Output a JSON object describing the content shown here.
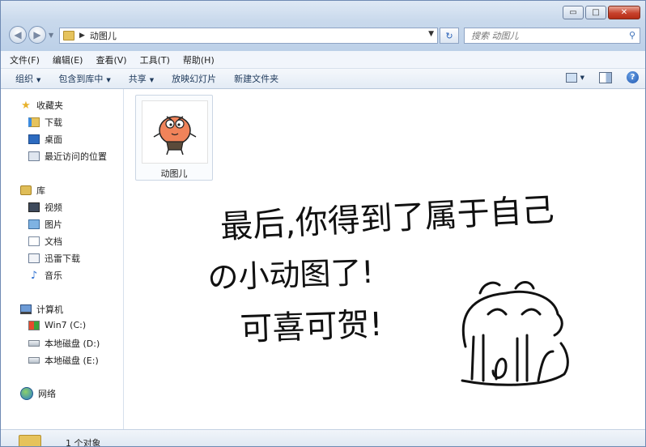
{
  "window": {
    "caption_buttons": {
      "minimize": "▭",
      "maximize": "□",
      "close": "✕"
    }
  },
  "toolbar": {
    "address_path": "动图儿",
    "search_placeholder": "搜索 动图儿"
  },
  "menubar": {
    "items": [
      "文件(F)",
      "编辑(E)",
      "查看(V)",
      "工具(T)",
      "帮助(H)"
    ]
  },
  "commandbar": {
    "items": [
      "组织",
      "包含到库中",
      "共享",
      "放映幻灯片",
      "新建文件夹"
    ]
  },
  "navpane": {
    "favorites": {
      "label": "收藏夹",
      "items": [
        "下载",
        "桌面",
        "最近访问的位置"
      ]
    },
    "libraries": {
      "label": "库",
      "items": [
        "视频",
        "图片",
        "文档",
        "迅雷下载",
        "音乐"
      ]
    },
    "computer": {
      "label": "计算机",
      "items": [
        "Win7 (C:)",
        "本地磁盘 (D:)",
        "本地磁盘 (E:)"
      ]
    },
    "network": {
      "label": "网络"
    }
  },
  "content": {
    "file": {
      "name": "动图儿"
    },
    "overlay_text": {
      "line1": "最后,你得到了属于自己",
      "line2": "の小动图了!",
      "line3": "可喜可贺!"
    }
  },
  "statusbar": {
    "text": "1 个对象"
  },
  "colors": {
    "frame": "#bcd0e8",
    "accent": "#2a62b8",
    "close": "#c7422d",
    "folder": "#e6c35c"
  }
}
